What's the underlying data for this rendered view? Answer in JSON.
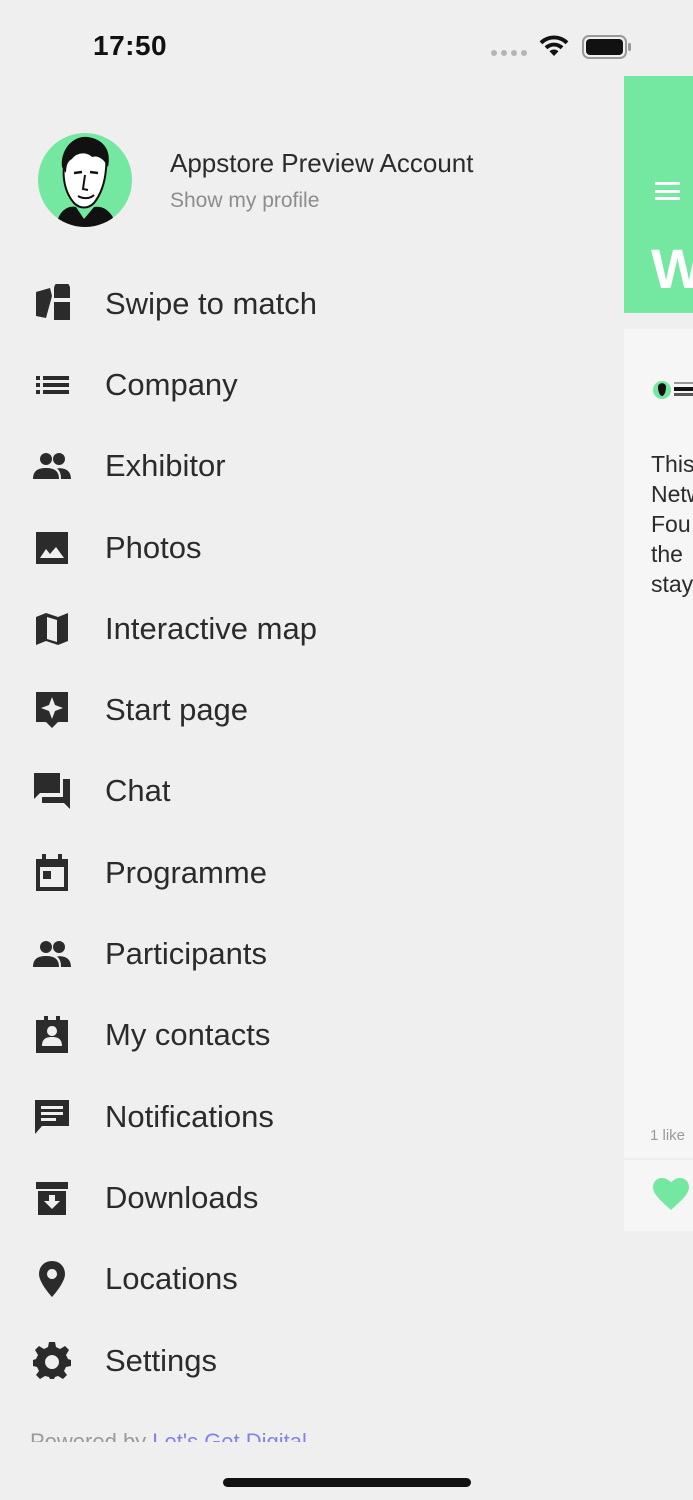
{
  "status_bar": {
    "time": "17:50"
  },
  "profile": {
    "name": "Appstore Preview Account",
    "subtitle": "Show my profile",
    "avatar_icon": "portrait-avatar",
    "avatar_color": "#74e8a0"
  },
  "menu": {
    "items": [
      {
        "label": "Swipe to match",
        "icon": "swipe-match-icon"
      },
      {
        "label": "Company",
        "icon": "list-icon"
      },
      {
        "label": "Exhibitor",
        "icon": "people-icon"
      },
      {
        "label": "Photos",
        "icon": "image-icon"
      },
      {
        "label": "Interactive map",
        "icon": "map-icon"
      },
      {
        "label": "Start page",
        "icon": "sparkle-icon"
      },
      {
        "label": "Chat",
        "icon": "chat-icon"
      },
      {
        "label": "Programme",
        "icon": "calendar-icon"
      },
      {
        "label": "Participants",
        "icon": "people-icon"
      },
      {
        "label": "My contacts",
        "icon": "contact-card-icon"
      },
      {
        "label": "Notifications",
        "icon": "message-icon"
      },
      {
        "label": "Downloads",
        "icon": "archive-icon"
      },
      {
        "label": "Locations",
        "icon": "location-pin-icon"
      },
      {
        "label": "Settings",
        "icon": "gear-icon"
      }
    ]
  },
  "footer": {
    "powered_prefix": "Powered by ",
    "powered_link": "Let's Get Digital"
  },
  "main_peek": {
    "title_fragment": "W",
    "text_lines": [
      "This",
      "Netw",
      "Fou",
      "the",
      "stay"
    ],
    "likes": "1 like",
    "accent_color": "#74e8a0"
  }
}
